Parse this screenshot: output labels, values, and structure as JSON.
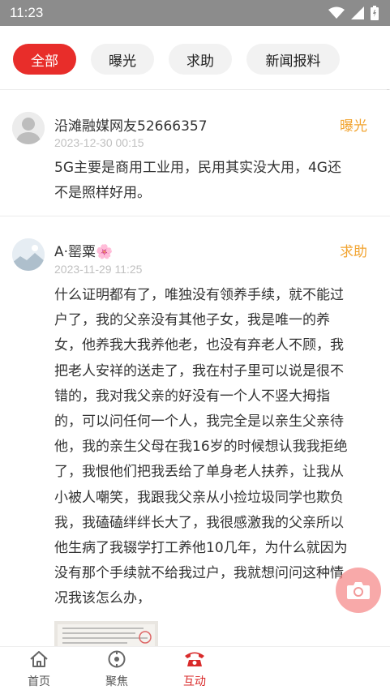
{
  "status_bar": {
    "time": "11:23"
  },
  "tabs": [
    {
      "label": "全部",
      "active": true
    },
    {
      "label": "曝光",
      "active": false
    },
    {
      "label": "求助",
      "active": false
    },
    {
      "label": "新闻报料",
      "active": false
    }
  ],
  "posts": [
    {
      "author": "沿滩融媒网友52666357",
      "date": "2023-12-30 00:15",
      "tag": "曝光",
      "content_lines": [
        "5G主要是商用工业用，民用其实没大用，4G还",
        "不是照样好用。"
      ]
    },
    {
      "author": "A·罂粟🌸",
      "date": "2023-11-29 11:25",
      "tag": "求助",
      "content_lines": [
        "什么证明都有了，唯独没有领养手续，就不能过",
        "户了，我的父亲没有其他子女，我是唯一的养",
        "女，他养我大我养他老，也没有弃老人不顾，我",
        "把老人安祥的送走了，我在村子里可以说是很不",
        "错的，我对我父亲的好没有一个人不竖大拇指",
        "的，可以问任何一个人，我完全是以亲生父亲待",
        "他，我的亲生父母在我16岁的时候想认我我拒绝",
        "了，我恨他们把我丢给了单身老人扶养，让我从",
        "小被人嘲笑，我跟我父亲从小捡垃圾同学也欺负",
        "我，我磕磕绊绊长大了，我很感激我的父亲所以",
        "他生病了我辍学打工养他10几年，为什么就因为",
        "没有那个手续就不给我过户，我就想问问这种情",
        "况我该怎么办，"
      ]
    }
  ],
  "bottom_nav": [
    {
      "label": "首页",
      "icon": "home-icon",
      "active": false
    },
    {
      "label": "聚焦",
      "icon": "focus-icon",
      "active": false
    },
    {
      "label": "互动",
      "icon": "phone-icon",
      "active": true
    }
  ],
  "colors": {
    "accent": "#e82d2a",
    "tag": "#f2a431",
    "statusbar": "#8c8c8c"
  }
}
